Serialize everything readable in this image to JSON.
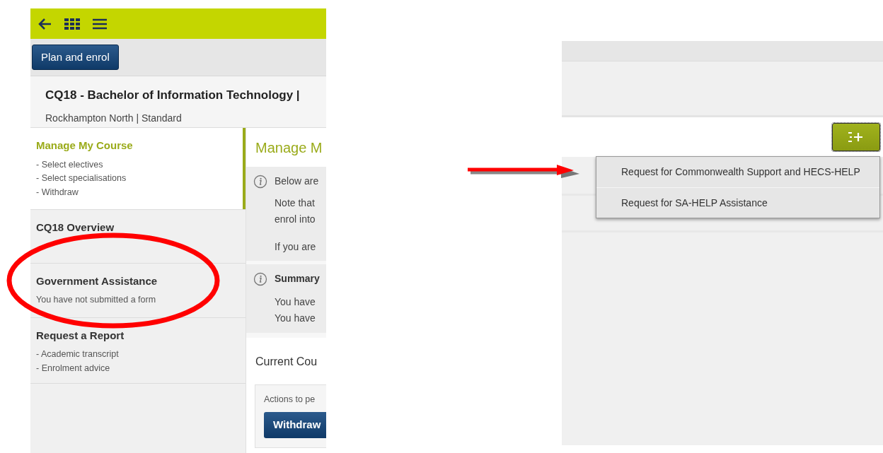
{
  "left_screen": {
    "plan_button": "Plan and enrol",
    "course": {
      "title": "CQ18 - Bachelor of Information Technology |",
      "subtitle": "Rockhampton North | Standard"
    },
    "sidebar": [
      {
        "title": "Manage My Course",
        "selected": true,
        "lines": [
          "- Select electives",
          "- Select specialisations",
          "- Withdraw"
        ]
      },
      {
        "title": "CQ18 Overview",
        "selected": false
      },
      {
        "title": "Government Assistance",
        "selected": false,
        "lines": [
          "You have not submitted a form"
        ]
      },
      {
        "title": "Request a Report",
        "selected": false,
        "lines": [
          "- Academic transcript",
          "- Enrolment advice"
        ]
      }
    ],
    "content": {
      "heading": "Manage M",
      "info": {
        "first": "Below are",
        "paragraphs": [
          "Note that",
          "enrol into",
          "If you are"
        ]
      },
      "summary": {
        "title": "Summary",
        "lines": [
          "You have",
          "You have"
        ]
      },
      "current_heading": "Current Cou",
      "actions_label": "Actions to pe",
      "withdraw_button": "Withdraw"
    }
  },
  "right_screen": {
    "menu": [
      "Request for Commonwealth Support and HECS-HELP",
      "Request for SA-HELP Assistance"
    ]
  }
}
